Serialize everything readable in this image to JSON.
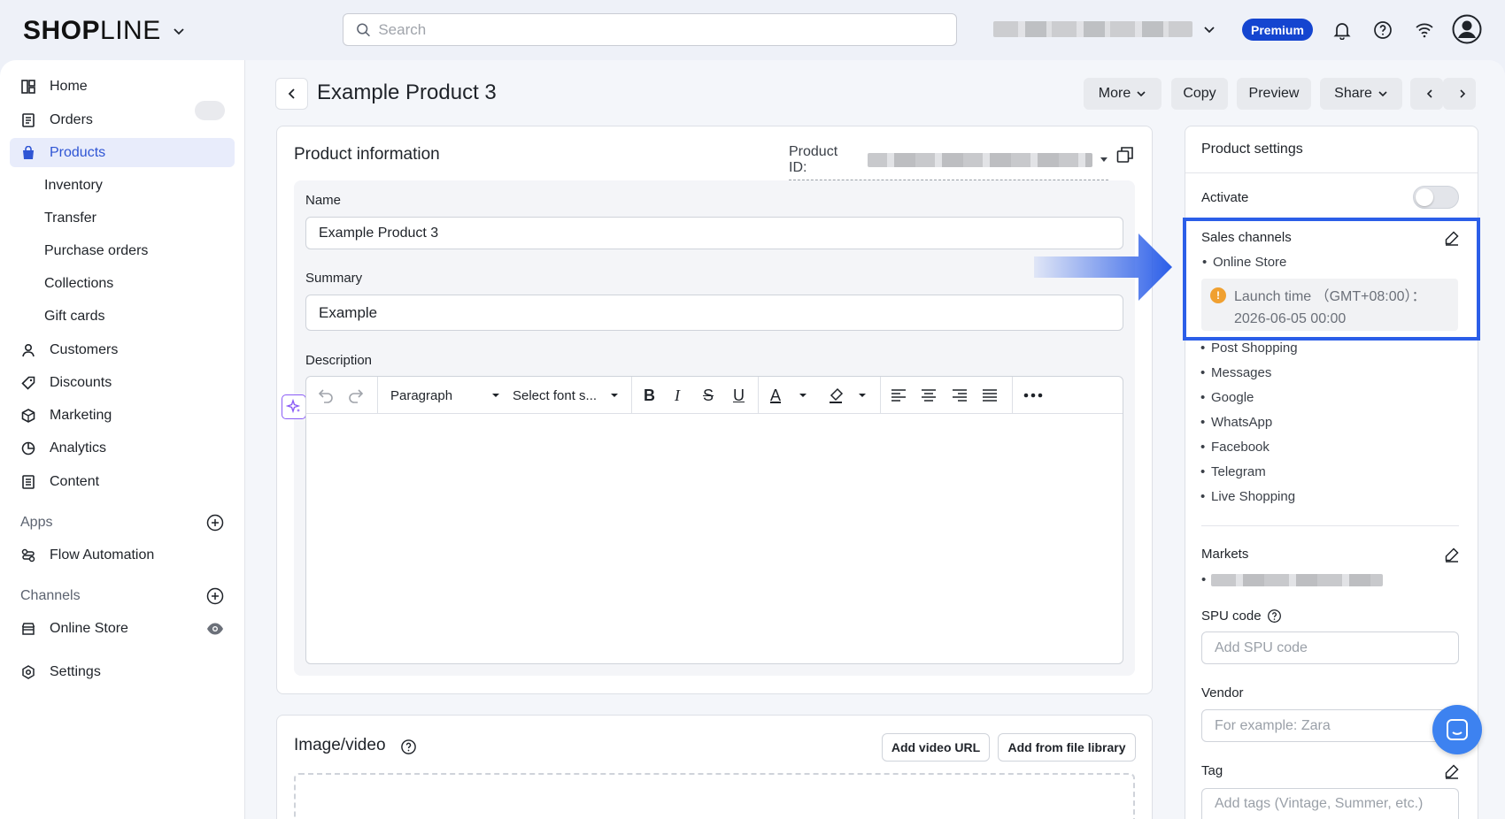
{
  "brand": {
    "logo_bold": "SHOP",
    "logo_thin": "LINE",
    "premium_label": "Premium",
    "accent": "#2f55d4"
  },
  "search": {
    "placeholder": "Search"
  },
  "sidebar": {
    "items": [
      {
        "label": "Home",
        "icon": "home-icon"
      },
      {
        "label": "Orders",
        "icon": "orders-icon"
      },
      {
        "label": "Products",
        "icon": "products-bag-icon"
      },
      {
        "label": "Inventory"
      },
      {
        "label": "Transfer"
      },
      {
        "label": "Purchase orders"
      },
      {
        "label": "Collections"
      },
      {
        "label": "Gift cards"
      },
      {
        "label": "Customers",
        "icon": "customers-icon"
      },
      {
        "label": "Discounts",
        "icon": "discount-tag-icon"
      },
      {
        "label": "Marketing",
        "icon": "marketing-icon"
      },
      {
        "label": "Analytics",
        "icon": "analytics-icon"
      },
      {
        "label": "Content",
        "icon": "content-icon"
      }
    ],
    "apps_label": "Apps",
    "flow_automation": "Flow Automation",
    "channels_label": "Channels",
    "online_store": "Online Store",
    "settings": "Settings"
  },
  "header": {
    "title": "Example Product 3",
    "more": "More",
    "copy": "Copy",
    "preview": "Preview",
    "share": "Share"
  },
  "product_info": {
    "title": "Product information",
    "product_id_label": "Product ID:",
    "name_label": "Name",
    "name_value": "Example Product 3",
    "summary_label": "Summary",
    "summary_value": "Example",
    "description_label": "Description",
    "toolbar": {
      "paragraph": "Paragraph",
      "font_size": "Select font s..."
    }
  },
  "media": {
    "title": "Image/video",
    "add_video_url": "Add video URL",
    "add_from_library": "Add from file library"
  },
  "settings": {
    "title": "Product settings",
    "activate_label": "Activate",
    "activate_on": false,
    "sales_channels_label": "Sales channels",
    "channels": [
      "Online Store",
      "Post Shopping",
      "Messages",
      "Google",
      "WhatsApp",
      "Facebook",
      "Telegram",
      "Live Shopping"
    ],
    "launch_line1": "Launch time （GMT+08:00）：",
    "launch_line2": "2026-06-05 00:00",
    "markets_label": "Markets",
    "spu_label": "SPU code",
    "spu_placeholder": "Add SPU code",
    "vendor_label": "Vendor",
    "vendor_placeholder": "For example: Zara",
    "tag_label": "Tag",
    "tag_placeholder": "Add tags (Vintage, Summer, etc.)"
  },
  "colors": {
    "highlight": "#2b5ee8",
    "premium": "#1445d0",
    "warning": "#f0a030",
    "chat": "#3d82f0"
  }
}
